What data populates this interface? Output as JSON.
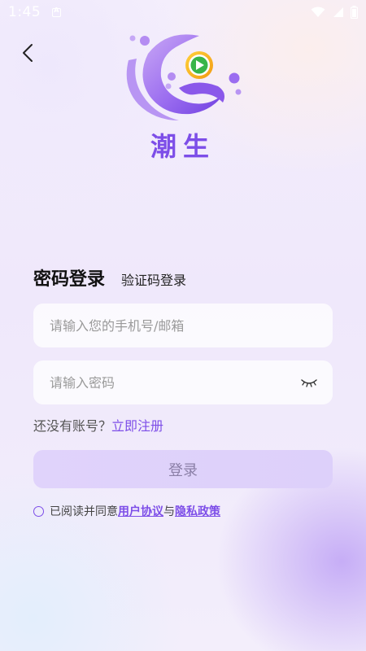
{
  "status_bar": {
    "time": "1:45",
    "icons": [
      "app-notification-icon",
      "wifi-icon",
      "signal-icon",
      "battery-icon"
    ]
  },
  "header": {
    "back_icon": "chevron-left-icon",
    "app_name": "潮生"
  },
  "login": {
    "tabs": [
      {
        "label": "密码登录",
        "active": true
      },
      {
        "label": "验证码登录",
        "active": false
      }
    ],
    "phone_field": {
      "placeholder": "请输入您的手机号/邮箱",
      "value": ""
    },
    "password_field": {
      "placeholder": "请输入密码",
      "value": "",
      "toggle_icon": "eye-closed-icon"
    },
    "register_prompt": "还没有账号？",
    "register_link": "立即注册",
    "submit_label": "登录"
  },
  "agreement": {
    "prefix": "已阅读并同意",
    "user_agreement": "用户协议",
    "connector": "与",
    "privacy_policy": "隐私政策",
    "checked": false
  },
  "colors": {
    "accent": "#7d4ee8",
    "button_bg": "#ddd0fa",
    "button_text": "#8a7fa6"
  }
}
